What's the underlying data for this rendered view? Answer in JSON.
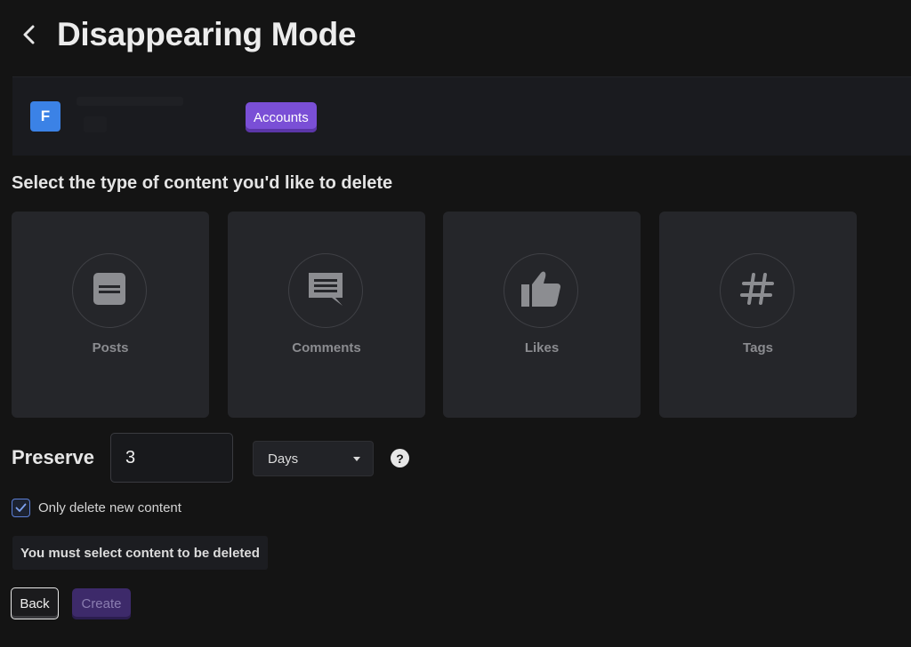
{
  "header": {
    "title": "Disappearing Mode",
    "back_icon": "chevron-left-icon"
  },
  "account_bar": {
    "avatar_letter": "F",
    "avatar_color": "#3b82e6",
    "accounts_label": "Accounts",
    "accent_color": "#7a4fd6"
  },
  "content_section": {
    "heading": "Select the type of content you'd like to delete",
    "cards": [
      {
        "label": "Posts",
        "icon": "post-icon"
      },
      {
        "label": "Comments",
        "icon": "comment-icon"
      },
      {
        "label": "Likes",
        "icon": "thumbs-up-icon"
      },
      {
        "label": "Tags",
        "icon": "hashtag-icon"
      }
    ]
  },
  "preserve": {
    "label": "Preserve",
    "value": "3",
    "unit_selected": "Days",
    "help_icon": "question-icon"
  },
  "options": {
    "only_new_label": "Only delete new content",
    "only_new_checked": true
  },
  "warning": "You must select content to be deleted",
  "footer": {
    "back_label": "Back",
    "create_label": "Create",
    "create_disabled": true
  }
}
